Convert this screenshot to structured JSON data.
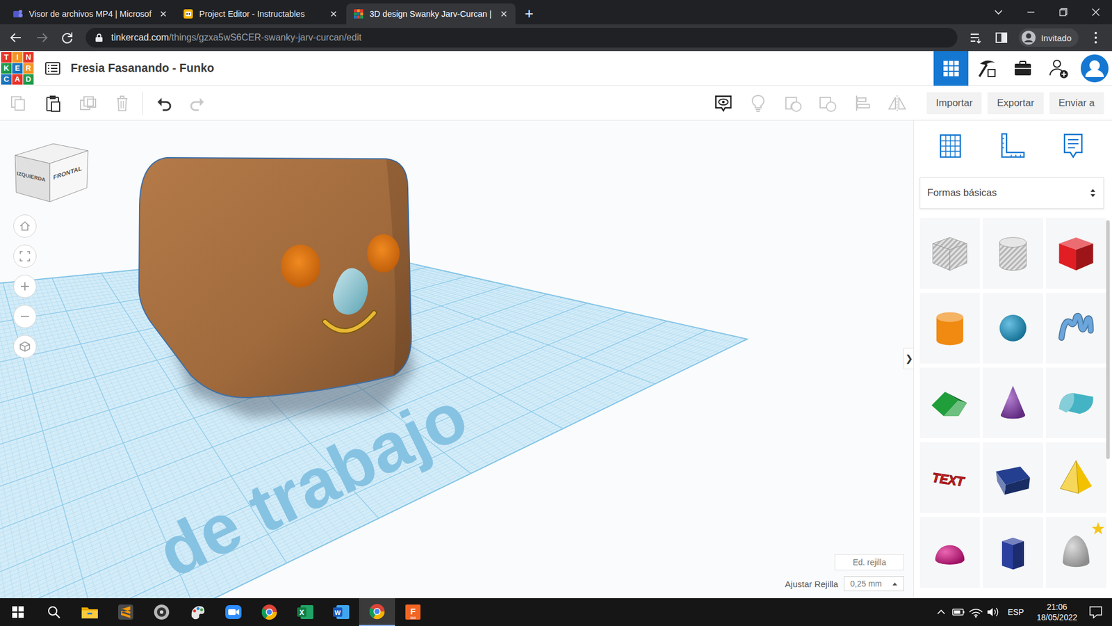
{
  "browser": {
    "tabs": [
      {
        "title": "Visor de archivos MP4 | Microsof",
        "favicon": "teams",
        "selected": false
      },
      {
        "title": "Project Editor - Instructables",
        "favicon": "instructables",
        "selected": false
      },
      {
        "title": "3D design Swanky Jarv-Curcan | ",
        "favicon": "tinkercad",
        "selected": true
      }
    ],
    "new_tab": "+",
    "url_host": "tinkercad.com",
    "url_path": "/things/gzxa5wS6CER-swanky-jarv-curcan/edit",
    "profile": "Invitado"
  },
  "app": {
    "logo": [
      {
        "letter": "T",
        "color": "#e8352b"
      },
      {
        "letter": "I",
        "color": "#f39424"
      },
      {
        "letter": "N",
        "color": "#e8352b"
      },
      {
        "letter": "K",
        "color": "#1f9b4b"
      },
      {
        "letter": "E",
        "color": "#1c75bc"
      },
      {
        "letter": "R",
        "color": "#f39424"
      },
      {
        "letter": "C",
        "color": "#1c75bc"
      },
      {
        "letter": "A",
        "color": "#e8352b"
      },
      {
        "letter": "D",
        "color": "#1f9b4b"
      }
    ],
    "title": "Fresia Fasanando - Funko",
    "header_buttons": [
      {
        "kind": "designs",
        "selected": true
      },
      {
        "kind": "build",
        "selected": false
      },
      {
        "kind": "lessons",
        "selected": false
      },
      {
        "kind": "invite",
        "selected": false
      },
      {
        "kind": "avatar",
        "selected": false
      }
    ]
  },
  "toolbar": {
    "left": [
      {
        "kind": "copy",
        "disabled": true
      },
      {
        "kind": "paste",
        "disabled": false
      },
      {
        "kind": "duplicate",
        "disabled": true
      },
      {
        "kind": "delete",
        "disabled": true
      },
      {
        "kind": "undo",
        "disabled": false
      },
      {
        "kind": "redo",
        "disabled": true
      }
    ],
    "right": [
      {
        "kind": "notes",
        "disabled": false
      },
      {
        "kind": "bulb",
        "disabled": true
      },
      {
        "kind": "group",
        "disabled": true
      },
      {
        "kind": "ungroup",
        "disabled": true
      },
      {
        "kind": "align",
        "disabled": true
      },
      {
        "kind": "mirror",
        "disabled": true
      }
    ],
    "buttons": [
      "Importar",
      "Exportar",
      "Enviar a"
    ]
  },
  "viewcube": {
    "left": "IZQUIERDA",
    "front": "FRONTAL"
  },
  "view_controls": [
    {
      "kind": "home"
    },
    {
      "kind": "fit"
    },
    {
      "kind": "zoom-in"
    },
    {
      "kind": "zoom-out"
    },
    {
      "kind": "perspective"
    }
  ],
  "workplane": {
    "label": "de trabajo"
  },
  "panel": {
    "tools": [
      {
        "kind": "workplane"
      },
      {
        "kind": "ruler"
      },
      {
        "kind": "notes"
      }
    ],
    "library": "Formas básicas",
    "collapse": "❯",
    "shapes": [
      {
        "kind": "box",
        "hole": true,
        "color": "#c4c4c4",
        "favorite": false,
        "label": ""
      },
      {
        "kind": "cylinder",
        "hole": true,
        "color": "#c4c4c4",
        "favorite": false,
        "label": ""
      },
      {
        "kind": "box",
        "hole": false,
        "color": "#e01e24",
        "favorite": false,
        "label": ""
      },
      {
        "kind": "cylinder",
        "hole": false,
        "color": "#f08a10",
        "favorite": false,
        "label": ""
      },
      {
        "kind": "sphere",
        "hole": false,
        "color": "#1a9ed2",
        "favorite": false,
        "label": ""
      },
      {
        "kind": "scribble",
        "hole": false,
        "color": "#6aa6dc",
        "favorite": false,
        "label": ""
      },
      {
        "kind": "roof",
        "hole": false,
        "color": "#1f9e3a",
        "favorite": false,
        "label": ""
      },
      {
        "kind": "cone",
        "hole": false,
        "color": "#8b3db8",
        "favorite": false,
        "label": ""
      },
      {
        "kind": "round-roof",
        "hole": false,
        "color": "#44b3c4",
        "favorite": false,
        "label": ""
      },
      {
        "kind": "text",
        "hole": false,
        "color": "#d21e1e",
        "favorite": false,
        "label": "TEXT"
      },
      {
        "kind": "wedge",
        "hole": false,
        "color": "#243f8f",
        "favorite": false,
        "label": ""
      },
      {
        "kind": "pyramid",
        "hole": false,
        "color": "#f2c200",
        "favorite": false,
        "label": ""
      },
      {
        "kind": "half-sphere",
        "hole": false,
        "color": "#e0158a",
        "favorite": false,
        "label": ""
      },
      {
        "kind": "polygon",
        "hole": false,
        "color": "#2a3f9e",
        "favorite": false,
        "label": ""
      },
      {
        "kind": "paraboloid",
        "hole": false,
        "color": "#c9c9c9",
        "favorite": true,
        "label": ""
      }
    ]
  },
  "grid": {
    "edit": "Ed. rejilla",
    "snap_label": "Ajustar Rejilla",
    "snap_value": "0,25 mm"
  },
  "taskbar": {
    "apps": [
      {
        "kind": "explorer",
        "glyph": "",
        "sub": "",
        "selected": false
      },
      {
        "kind": "sublime",
        "glyph": "",
        "sub": "",
        "selected": false
      },
      {
        "kind": "obs",
        "glyph": "",
        "sub": "",
        "selected": false
      },
      {
        "kind": "paint",
        "glyph": "",
        "sub": "",
        "selected": false
      },
      {
        "kind": "zoom",
        "glyph": "",
        "sub": "",
        "selected": false
      },
      {
        "kind": "chrome",
        "glyph": "",
        "sub": "",
        "selected": false
      },
      {
        "kind": "excel",
        "glyph": "X",
        "sub": "",
        "selected": false
      },
      {
        "kind": "word",
        "glyph": "W",
        "sub": "",
        "selected": false
      },
      {
        "kind": "chrome",
        "glyph": "",
        "sub": "",
        "selected": true
      },
      {
        "kind": "fusion",
        "glyph": "F",
        "sub": "360",
        "selected": false
      }
    ],
    "lang": "ESP",
    "time": "21:06",
    "date": "18/05/2022"
  }
}
